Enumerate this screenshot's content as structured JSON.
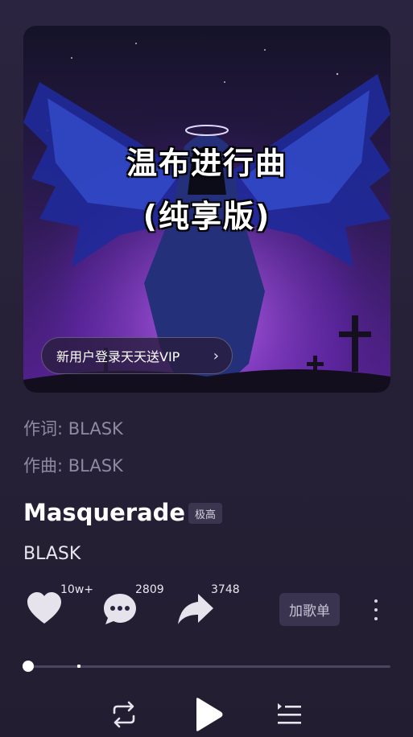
{
  "cover": {
    "title_line1": "温布进行曲",
    "title_line2": "(纯享版)",
    "vip_promo": "新用户登录天天送VIP",
    "vip_chevron": "›"
  },
  "credits": {
    "lyricist": "作词: BLASK",
    "composer": "作曲: BLASK"
  },
  "song": {
    "title": "Masquerade",
    "quality_badge": "极高",
    "artist": "BLASK"
  },
  "actions": {
    "like_count": "10w+",
    "comment_count": "2809",
    "share_count": "3748",
    "add_to_playlist": "加歌单"
  },
  "playback": {
    "progress": 0.0,
    "buffered": 0.14
  },
  "icons": {
    "like": "heart-icon",
    "comment": "comment-icon",
    "share": "share-icon",
    "more": "more-vertical-icon",
    "repeat": "repeat-icon",
    "play": "play-icon",
    "playlist": "playlist-icon"
  },
  "colors": {
    "background": "#2a2440",
    "muted_text": "#8f8aa2",
    "accent_purple": "#7e2fc9"
  }
}
